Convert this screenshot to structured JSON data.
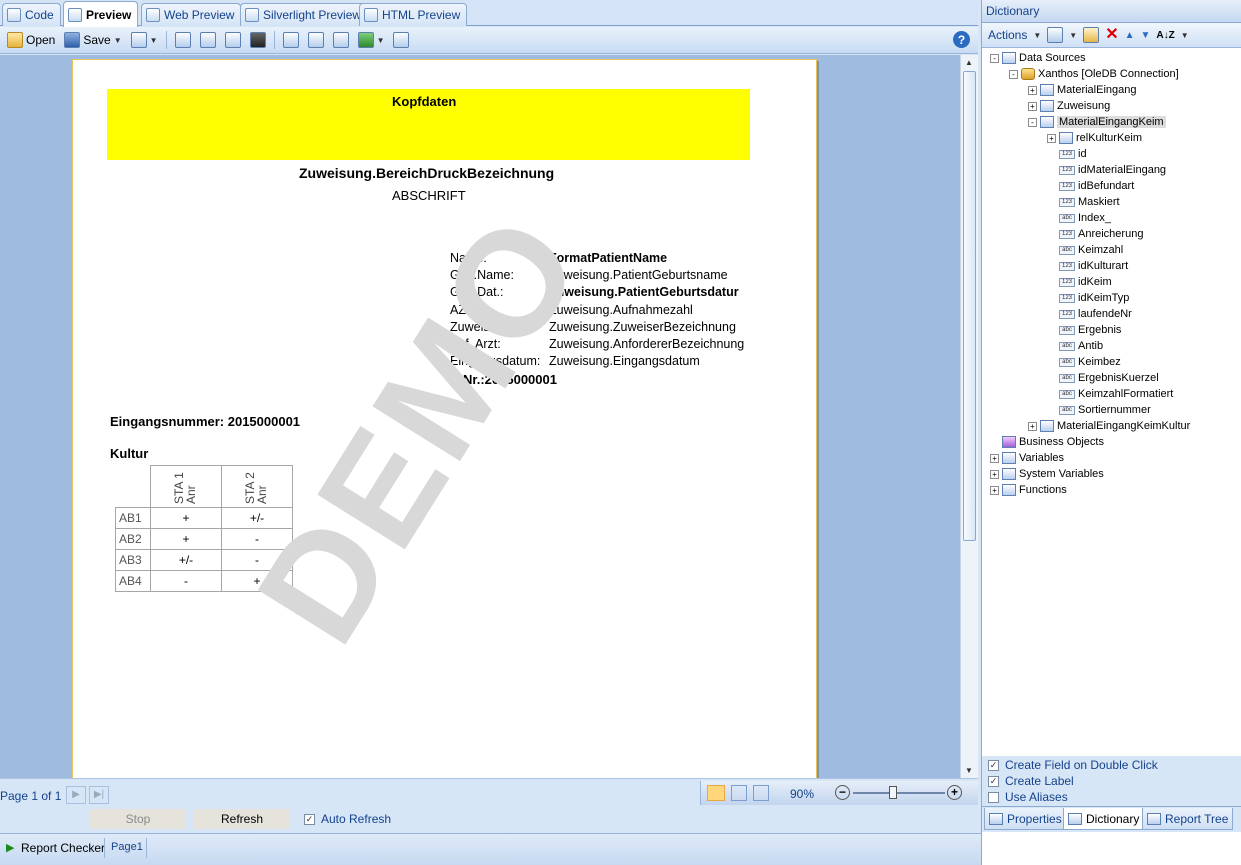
{
  "tabs": [
    {
      "label": "Code",
      "icon": "code-icon"
    },
    {
      "label": "Preview",
      "icon": "preview-icon"
    },
    {
      "label": "Web Preview",
      "icon": "web-preview-icon"
    },
    {
      "label": "Silverlight Preview",
      "icon": "silverlight-icon"
    },
    {
      "label": "HTML Preview",
      "icon": "html-preview-icon"
    }
  ],
  "toolbar": {
    "open_label": "Open",
    "save_label": "Save",
    "help": "?"
  },
  "report": {
    "header_band": "Kopfdaten",
    "title": "Zuweisung.BereichDruckBezeichnung",
    "subtitle": "ABSCHRIFT",
    "fields": [
      {
        "label": "Name:",
        "value": "FormatPatientName",
        "bold": true
      },
      {
        "label": "Geb.Name:",
        "value": "Zuweisung.PatientGeburtsname",
        "bold": false
      },
      {
        "label": "Geb.Dat.:",
        "value": "Zuweisung.PatientGeburtsdatur",
        "bold": true
      },
      {
        "label": "AZ:",
        "value": "Zuweisung.Aufnahmezahl",
        "bold": false
      },
      {
        "label": "Zuweiser:",
        "value": "Zuweisung.ZuweiserBezeichnung",
        "bold": false
      },
      {
        "label": "Anf. Arzt:",
        "value": "Zuweisung.AnfordererBezeichnung",
        "bold": false
      },
      {
        "label": "Eingangsdatum:",
        "value": "Zuweisung.Eingangsdatum",
        "bold": false
      }
    ],
    "enr": "E-Nr.:2015000001",
    "eingangsnummer": "Eingangsnummer: 2015000001",
    "kultur": "Kultur",
    "table_headers": [
      "STA 1\nAnr",
      "STA 2\nAnr"
    ],
    "table_header_lines": [
      [
        "STA 1",
        "Anr"
      ],
      [
        "STA 2",
        "Anr"
      ]
    ],
    "table_rows": [
      {
        "name": "AB1",
        "c1": "+",
        "c2": "+/-"
      },
      {
        "name": "AB2",
        "c1": "+",
        "c2": "-"
      },
      {
        "name": "AB3",
        "c1": "+/-",
        "c2": "-"
      },
      {
        "name": "AB4",
        "c1": "-",
        "c2": "+"
      }
    ],
    "watermark": "DEMO"
  },
  "viewer_status": {
    "page_info": "Page 1 of 1",
    "zoom": "90%",
    "stop_label": "Stop",
    "refresh_label": "Refresh",
    "auto_refresh_label": "Auto Refresh",
    "auto_refresh_checked": true
  },
  "bottom": {
    "report_checker": "Report Checker",
    "page_tab": "Page1"
  },
  "dictionary": {
    "title": "Dictionary",
    "actions_label": "Actions",
    "tree": [
      {
        "label": "Data Sources",
        "level": 0,
        "exp": "-",
        "icon": "datasource-icon"
      },
      {
        "label": "Xanthos [OleDB Connection]",
        "level": 1,
        "exp": "-",
        "icon": "database-icon"
      },
      {
        "label": "MaterialEingang",
        "level": 2,
        "exp": "+",
        "icon": "table-icon"
      },
      {
        "label": "Zuweisung",
        "level": 2,
        "exp": "+",
        "icon": "table-icon"
      },
      {
        "label": "MaterialEingangKeim",
        "level": 2,
        "exp": "-",
        "icon": "table-icon",
        "selected": true
      },
      {
        "label": "relKulturKeim",
        "level": 3,
        "exp": "+",
        "icon": "relation-icon"
      },
      {
        "label": "id",
        "level": 3,
        "type": "123"
      },
      {
        "label": "idMaterialEingang",
        "level": 3,
        "type": "123"
      },
      {
        "label": "idBefundart",
        "level": 3,
        "type": "123"
      },
      {
        "label": "Maskiert",
        "level": 3,
        "type": "123"
      },
      {
        "label": "Index_",
        "level": 3,
        "type": "abc"
      },
      {
        "label": "Anreicherung",
        "level": 3,
        "type": "123"
      },
      {
        "label": "Keimzahl",
        "level": 3,
        "type": "abc"
      },
      {
        "label": "idKulturart",
        "level": 3,
        "type": "123"
      },
      {
        "label": "idKeim",
        "level": 3,
        "type": "123"
      },
      {
        "label": "idKeimTyp",
        "level": 3,
        "type": "123"
      },
      {
        "label": "laufendeNr",
        "level": 3,
        "type": "123"
      },
      {
        "label": "Ergebnis",
        "level": 3,
        "type": "abc"
      },
      {
        "label": "Antib",
        "level": 3,
        "type": "abc"
      },
      {
        "label": "Keimbez",
        "level": 3,
        "type": "abc"
      },
      {
        "label": "ErgebnisKuerzel",
        "level": 3,
        "type": "abc"
      },
      {
        "label": "KeimzahlFormatiert",
        "level": 3,
        "type": "abc"
      },
      {
        "label": "Sortiernummer",
        "level": 3,
        "type": "abc"
      },
      {
        "label": "MaterialEingangKeimKultur",
        "level": 2,
        "exp": "+",
        "icon": "table-icon"
      },
      {
        "label": "Business Objects",
        "level": 0,
        "icon": "business-objects-icon"
      },
      {
        "label": "Variables",
        "level": 0,
        "exp": "+",
        "icon": "variables-icon"
      },
      {
        "label": "System Variables",
        "level": 0,
        "exp": "+",
        "icon": "system-variables-icon"
      },
      {
        "label": "Functions",
        "level": 0,
        "exp": "+",
        "icon": "functions-icon"
      }
    ],
    "options": [
      {
        "label": "Create Field on Double Click",
        "checked": true
      },
      {
        "label": "Create Label",
        "checked": true
      },
      {
        "label": "Use Aliases",
        "checked": false
      }
    ],
    "tabs": [
      "Properties",
      "Dictionary",
      "Report Tree"
    ]
  }
}
